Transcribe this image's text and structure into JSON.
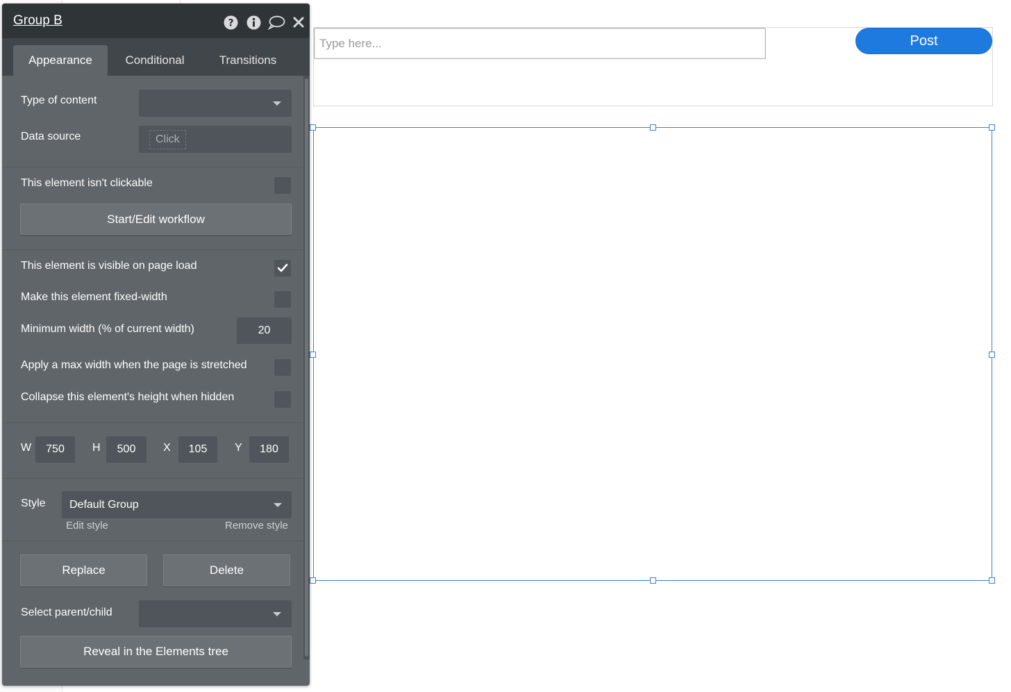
{
  "canvas": {
    "input_placeholder": "Type here...",
    "post_button_label": "Post"
  },
  "panel": {
    "title": "Group B",
    "header_icons": [
      "help-icon",
      "info-icon",
      "comment-icon",
      "close-icon"
    ],
    "tabs": [
      {
        "label": "Appearance",
        "active": true
      },
      {
        "label": "Conditional",
        "active": false
      },
      {
        "label": "Transitions",
        "active": false
      }
    ],
    "type_of_content_label": "Type of content",
    "type_of_content_value": "",
    "data_source_label": "Data source",
    "data_source_value": "Click",
    "not_clickable_label": "This element isn't clickable",
    "not_clickable_checked": false,
    "workflow_button": "Start/Edit workflow",
    "visible_on_load_label": "This element is visible on page load",
    "visible_on_load_checked": true,
    "fixed_width_label": "Make this element fixed-width",
    "fixed_width_checked": false,
    "min_width_label": "Minimum width (% of current width)",
    "min_width_value": "20",
    "max_width_label": "Apply a max width when the page is stretched",
    "max_width_checked": false,
    "collapse_label": "Collapse this element's height when hidden",
    "collapse_checked": false,
    "dims": {
      "w_label": "W",
      "w_value": "750",
      "h_label": "H",
      "h_value": "500",
      "x_label": "X",
      "x_value": "105",
      "y_label": "Y",
      "y_value": "180"
    },
    "style_label": "Style",
    "style_value": "Default Group",
    "edit_style": "Edit style",
    "remove_style": "Remove style",
    "replace_button": "Replace",
    "delete_button": "Delete",
    "parent_child_label": "Select parent/child",
    "parent_child_value": "",
    "reveal_button": "Reveal in the Elements tree"
  },
  "colors": {
    "accent": "#1f7ae0",
    "selection": "#3a7fd8",
    "panel_bg": "#5f6569",
    "panel_header": "#2f3436"
  }
}
